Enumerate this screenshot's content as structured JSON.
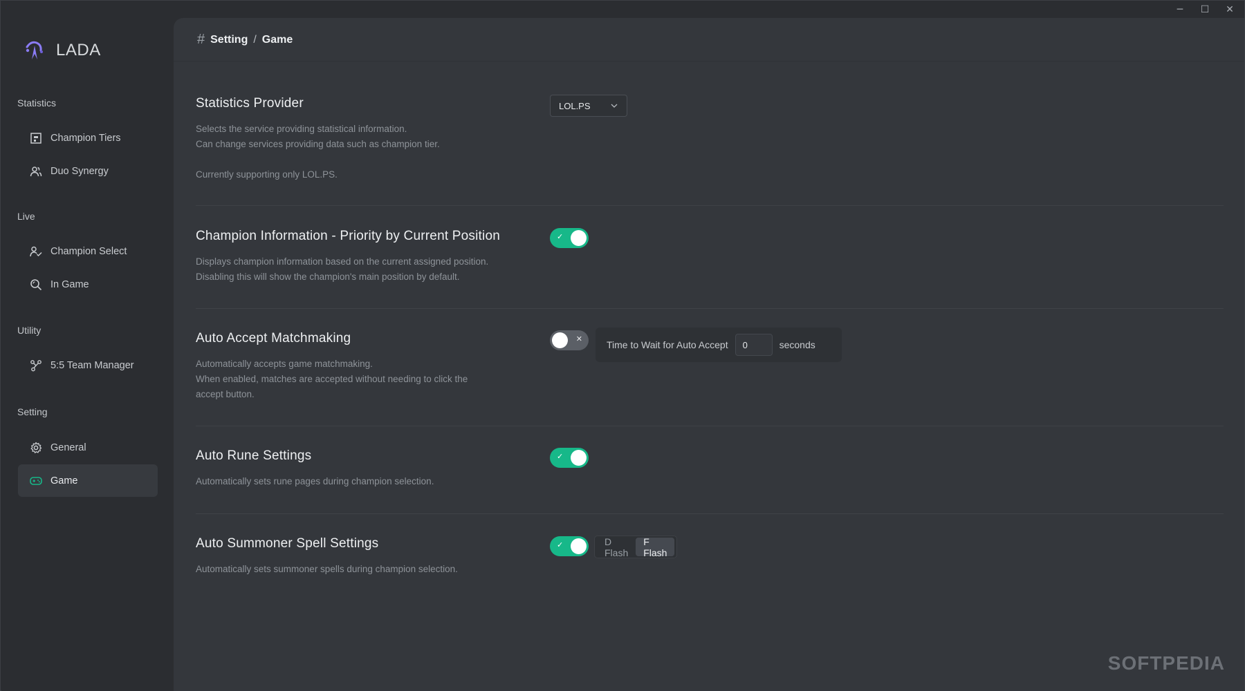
{
  "app": {
    "name": "LADA"
  },
  "window_controls": {
    "minimize": "─",
    "maximize": "☐",
    "close": "✕"
  },
  "sidebar": {
    "sections": [
      {
        "label": "Statistics",
        "items": [
          {
            "label": "Champion Tiers",
            "icon": "tier-list-icon"
          },
          {
            "label": "Duo Synergy",
            "icon": "users-icon"
          }
        ]
      },
      {
        "label": "Live",
        "items": [
          {
            "label": "Champion Select",
            "icon": "user-check-icon"
          },
          {
            "label": "In Game",
            "icon": "search-icon"
          }
        ]
      },
      {
        "label": "Utility",
        "items": [
          {
            "label": "5:5 Team Manager",
            "icon": "network-icon"
          }
        ]
      },
      {
        "label": "Setting",
        "items": [
          {
            "label": "General",
            "icon": "gear-icon"
          },
          {
            "label": "Game",
            "icon": "gamepad-icon",
            "active": true
          }
        ]
      }
    ]
  },
  "breadcrumb": {
    "hash": "#",
    "parent": "Setting",
    "separator": "/",
    "current": "Game"
  },
  "settings": {
    "provider": {
      "title": "Statistics Provider",
      "desc1": "Selects the service providing statistical information.",
      "desc2": "Can change services providing data such as champion tier.",
      "desc3": "Currently supporting only LOL.PS.",
      "selected": "LOL.PS"
    },
    "position_priority": {
      "title": "Champion Information - Priority by Current Position",
      "desc1": "Displays champion information based on the current assigned position.",
      "desc2": "Disabling this will show the champion's main position by default.",
      "enabled": true
    },
    "auto_accept": {
      "title": "Auto Accept Matchmaking",
      "desc1": "Automatically accepts game matchmaking.",
      "desc2": "When enabled, matches are accepted without needing to click the",
      "desc3": "accept button.",
      "enabled": false,
      "wait_label": "Time to Wait for Auto Accept",
      "wait_value": "0",
      "wait_unit": "seconds"
    },
    "auto_rune": {
      "title": "Auto Rune Settings",
      "desc1": "Automatically sets rune pages during champion selection.",
      "enabled": true
    },
    "auto_spell": {
      "title": "Auto Summoner Spell Settings",
      "desc1": "Automatically sets summoner spells during champion selection.",
      "enabled": true,
      "options": [
        "D Flash",
        "F Flash"
      ],
      "selected": "F Flash"
    }
  },
  "toggle_marks": {
    "on": "✓",
    "off": "✕"
  },
  "watermark": "SOFTPEDIA",
  "colors": {
    "accent": "#17b889",
    "accent_logo": "#8b7cf6",
    "sidebar_bg": "#2b2d31",
    "main_bg": "#34373c"
  }
}
